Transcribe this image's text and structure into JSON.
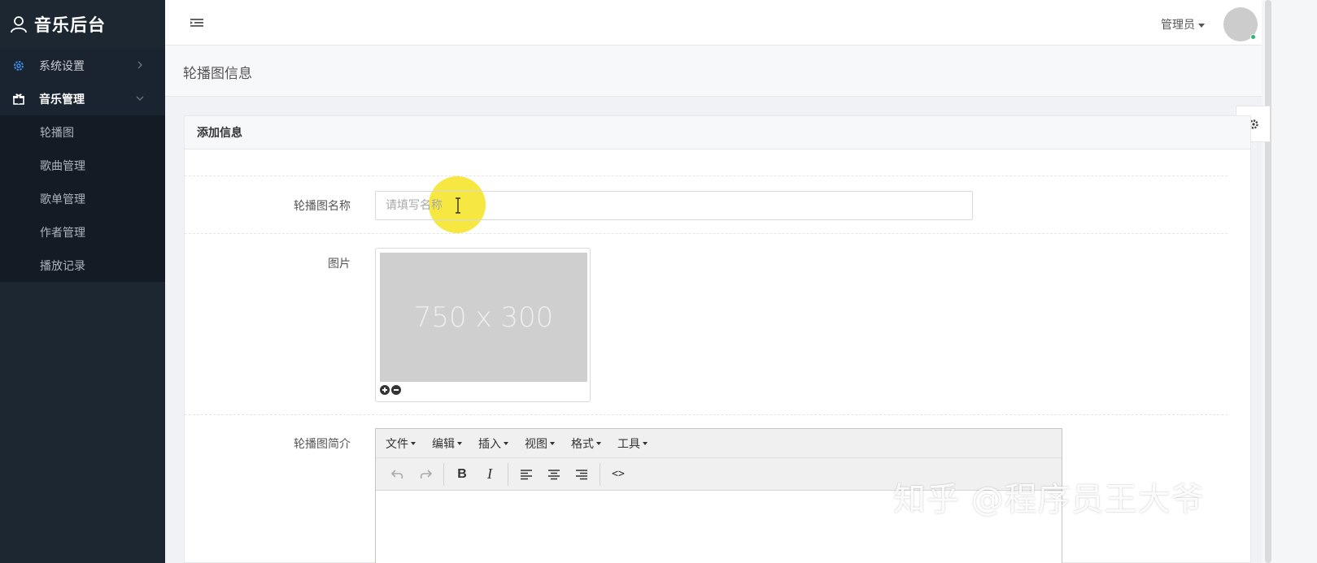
{
  "brand": {
    "title": "音乐后台"
  },
  "sidebar": {
    "items": [
      {
        "label": "系统设置",
        "icon": "gear-icon"
      },
      {
        "label": "音乐管理",
        "icon": "gift-icon"
      }
    ],
    "subitems": [
      {
        "label": "轮播图"
      },
      {
        "label": "歌曲管理"
      },
      {
        "label": "歌单管理"
      },
      {
        "label": "作者管理"
      },
      {
        "label": "播放记录"
      }
    ]
  },
  "topbar": {
    "user": "管理员"
  },
  "page": {
    "title": "轮播图信息"
  },
  "panel": {
    "title": "添加信息",
    "fields": {
      "name_label": "轮播图名称",
      "name_placeholder": "请填写名称",
      "image_label": "图片",
      "image_placeholder_text": "750 x 300",
      "intro_label": "轮播图简介"
    }
  },
  "editor": {
    "menu": [
      "文件",
      "编辑",
      "插入",
      "视图",
      "格式",
      "工具"
    ],
    "toolbar": {
      "bold": "B",
      "italic": "I",
      "code": "<>"
    }
  },
  "watermark": "知乎 @程序员王大爷",
  "colors": {
    "sidebar_bg": "#1c2732",
    "accent": "#3a8ee6",
    "online": "#2bb673",
    "highlight": "#f5e52b"
  }
}
